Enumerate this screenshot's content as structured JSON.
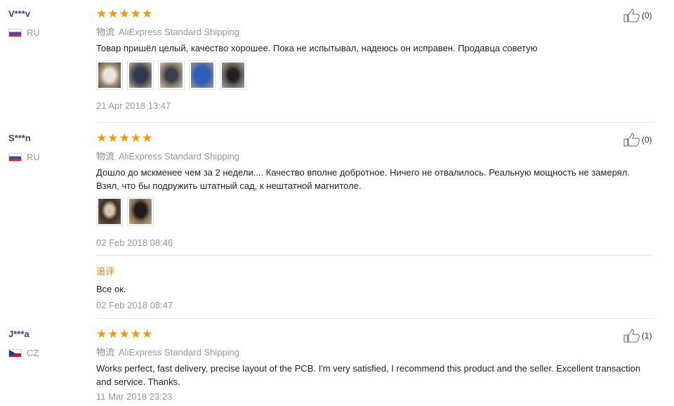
{
  "reviews": [
    {
      "user": "V***v",
      "country": "RU",
      "rating": 5,
      "logistics_label": "物流",
      "shipping": "AliExpress Standard Shipping",
      "text": "Товар пришёл целый, качество хорошее. Пока не испытывал, надеюсь он исправен. Продавца советую",
      "photo_count": 5,
      "date": "21 Apr 2018 13:47",
      "helpful": "(0)"
    },
    {
      "user": "S***n",
      "country": "RU",
      "rating": 5,
      "logistics_label": "物流",
      "shipping": "AliExpress Standard Shipping",
      "text": "Дошло до мскменее чем за 2 недели.... Качество вполне добротное. Ничего не отвалилось. Реальную мощность не замерял. Взял, что бы подружить штатный сад, к нештатной магнитоле.",
      "photo_count": 2,
      "date": "02 Feb 2018 08:46",
      "followup_label": "追评",
      "followup_text": "Все ок.",
      "followup_date": "02 Feb 2018 08:47",
      "helpful": "(0)"
    },
    {
      "user": "J***a",
      "country": "CZ",
      "rating": 5,
      "logistics_label": "物流",
      "shipping": "AliExpress Standard Shipping",
      "text": "Works perfect, fast delivery, precise layout of the PCB. I'm very satisfied, I recommend this product and the seller. Excellent transaction and service. Thanks.",
      "date": "11 Mar 2018 23:23",
      "helpful": "(1)"
    }
  ],
  "icons": {
    "rating_star": "star-icon",
    "helpful": "thumbs-up-icon",
    "flag": "flag-icon"
  },
  "colors": {
    "star": "#f79800",
    "username": "#2c4a7c",
    "followup_label": "#e0831a",
    "muted": "#999999"
  }
}
